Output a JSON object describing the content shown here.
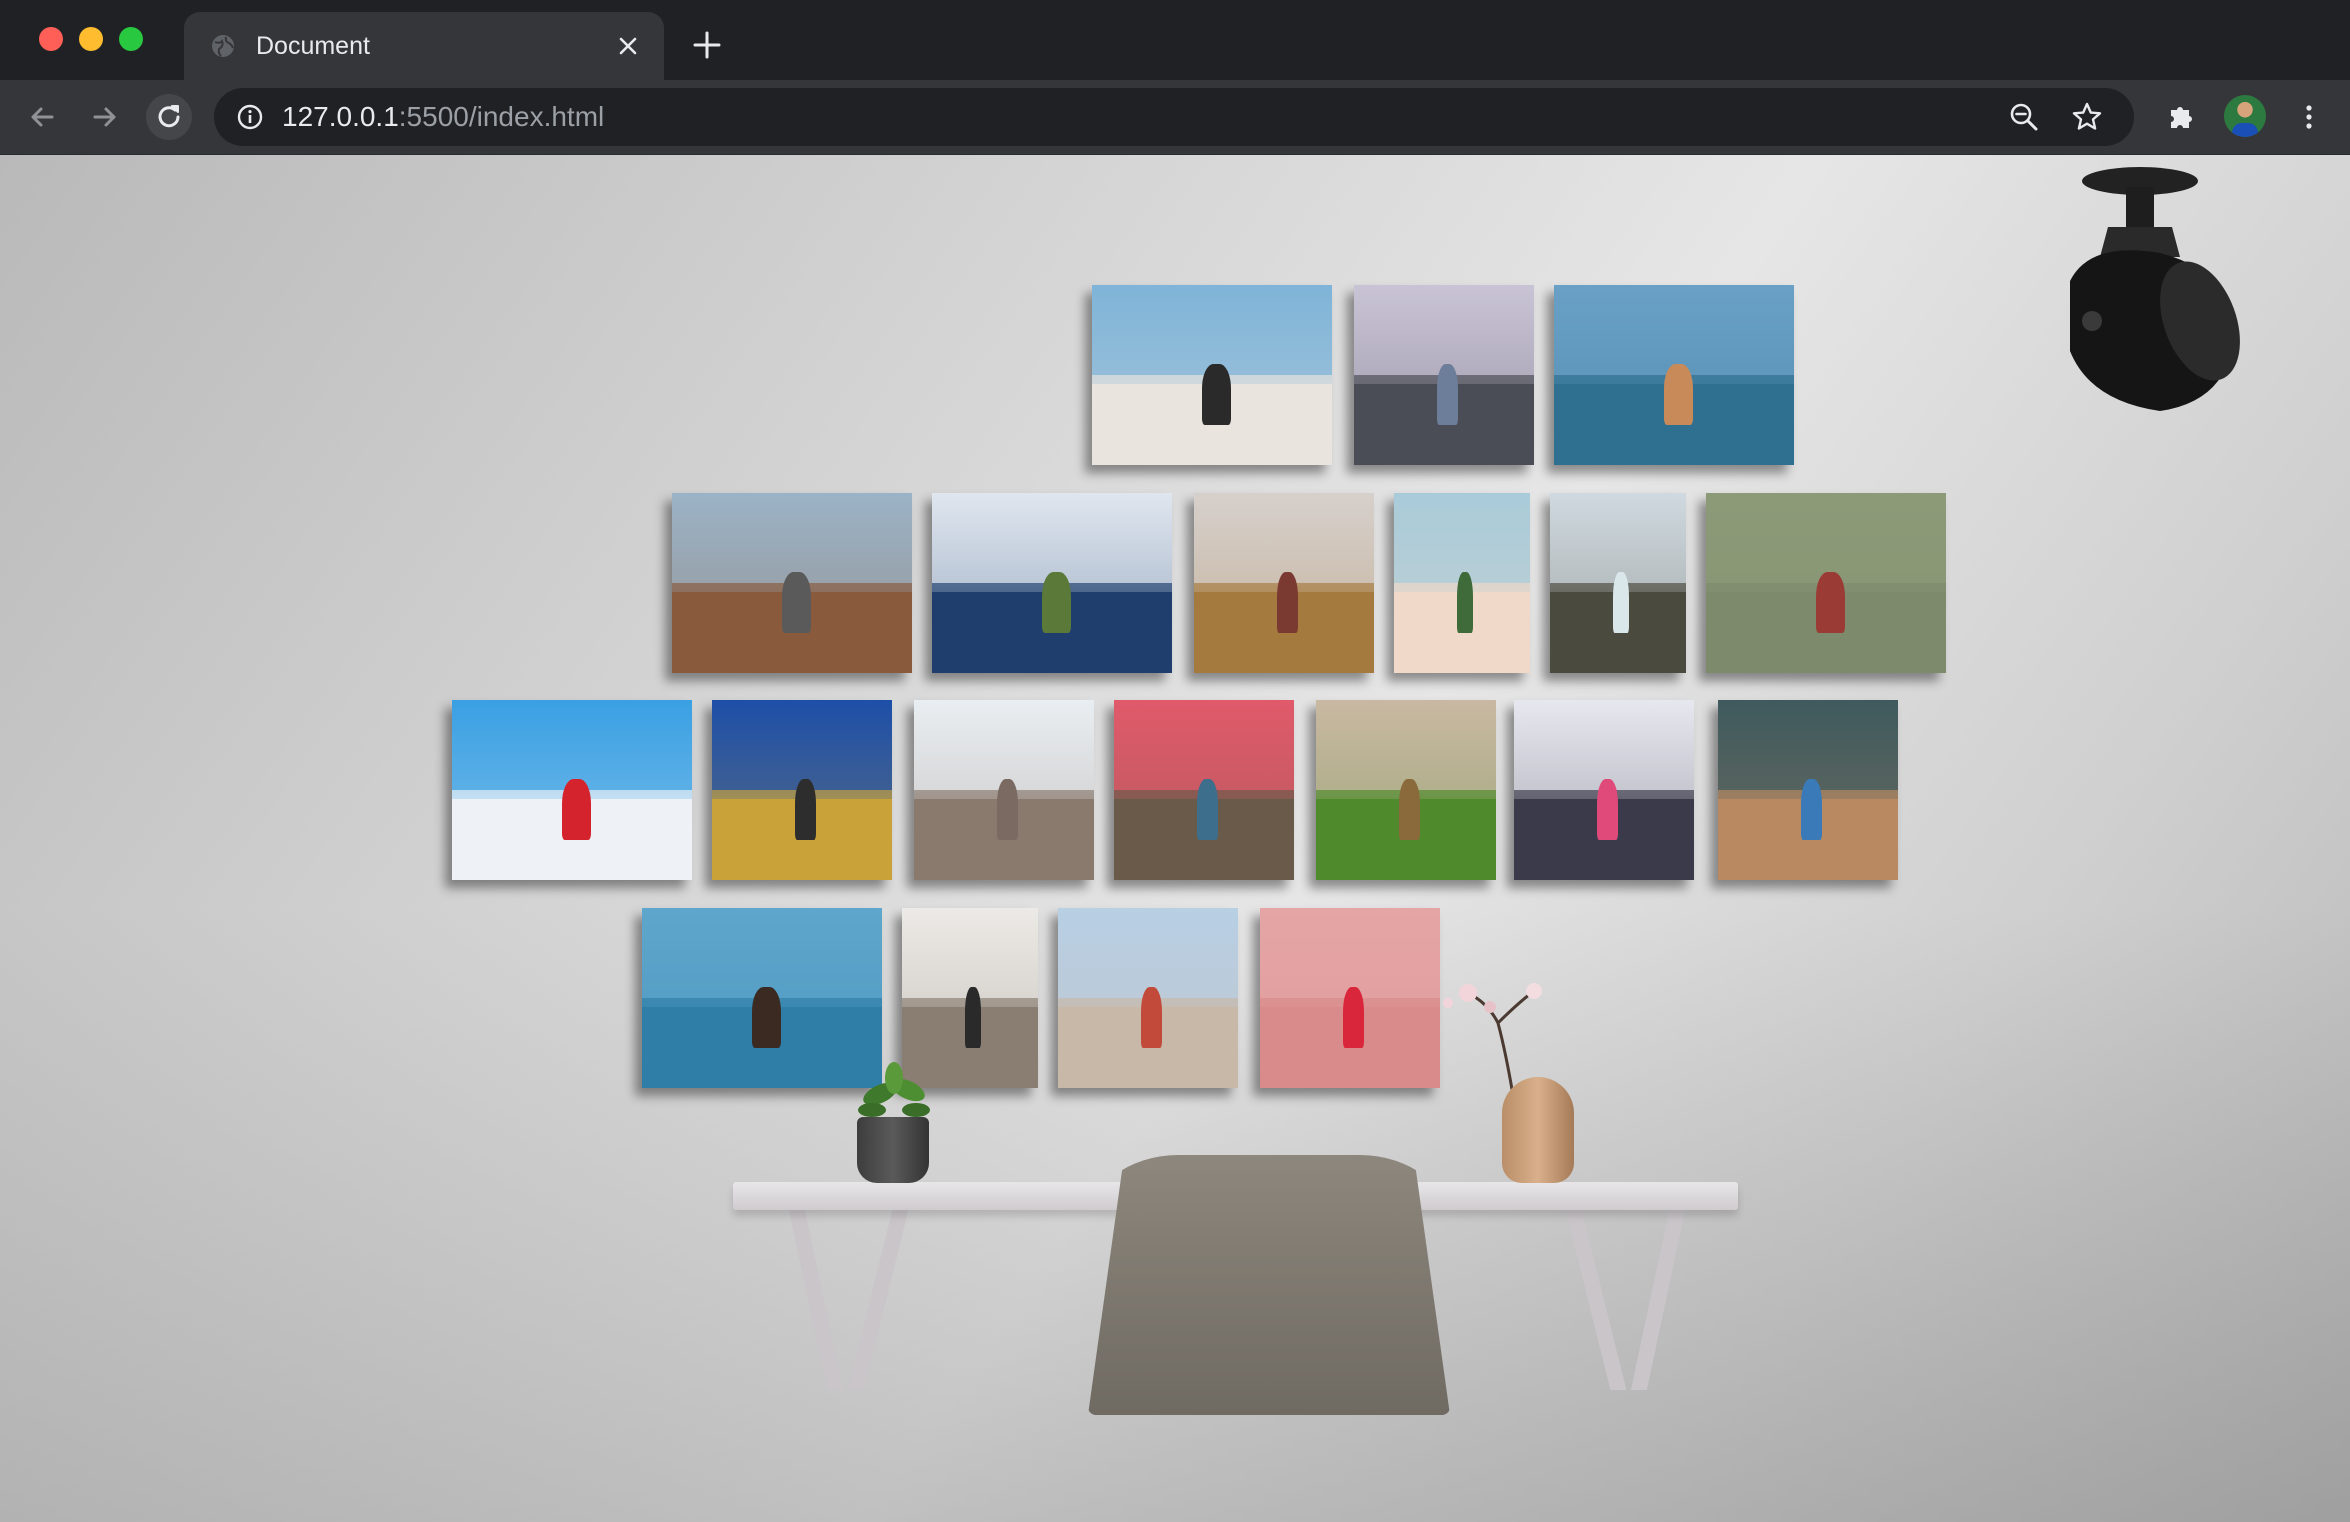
{
  "browser": {
    "tab": {
      "title": "Document"
    },
    "address_bar": {
      "host": "127.0.0.1",
      "path": ":5500/index.html"
    }
  },
  "icons": {
    "tab_favicon": "globe-icon",
    "tab_close": "close-icon",
    "new_tab": "plus-icon",
    "back": "arrow-left-icon",
    "forward": "arrow-right-icon",
    "reload": "reload-icon",
    "site_info": "info-icon",
    "zoom": "zoom-out-icon",
    "bookmark": "star-icon",
    "extensions": "puzzle-icon",
    "menu": "kebab-menu-icon"
  },
  "colors": {
    "titlebar": "#202124",
    "toolbar": "#35363a",
    "wall_light": "#e6e6e6",
    "wall_dark": "#b4b4b4"
  },
  "gallery": {
    "rows": [
      {
        "photos": [
          {
            "name": "hot-air-balloons-snow",
            "sky": "#7fb4d8",
            "ground": "#e9e4de",
            "figure": "#2a2a2a"
          },
          {
            "name": "snowy-coast-rocks",
            "sky": "#c9c3d6",
            "ground": "#4a4d55",
            "figure": "#6d7e9a"
          },
          {
            "name": "kayak-lake-mountain",
            "sky": "#6aa0c6",
            "ground": "#2f6f8f",
            "figure": "#c98a5a"
          }
        ]
      },
      {
        "photos": [
          {
            "name": "canyon-overlook",
            "sky": "#9bb3c6",
            "ground": "#8a5a3c",
            "figure": "#5a5a5a"
          },
          {
            "name": "mountain-lake-reflection",
            "sky": "#dfe6ef",
            "ground": "#1f3e6e",
            "figure": "#5b7a3a"
          },
          {
            "name": "wheat-field-blanket",
            "sky": "#d6d0cc",
            "ground": "#a57a3e",
            "figure": "#7a3a32"
          },
          {
            "name": "tropical-beach",
            "sky": "#a9cbd9",
            "ground": "#f0d9c8",
            "figure": "#3f6a3a"
          },
          {
            "name": "waterfall-cliffs",
            "sky": "#cfd9df",
            "ground": "#4b4a3e",
            "figure": "#d9e6ea"
          },
          {
            "name": "photographer-river",
            "sky": "#8c9a78",
            "ground": "#7d8a6c",
            "figure": "#9b3b35"
          }
        ]
      },
      {
        "photos": [
          {
            "name": "santorini-red-dress",
            "sky": "#3aa0e3",
            "ground": "#eef2f6",
            "figure": "#d5232e"
          },
          {
            "name": "snow-peak-meadow",
            "sky": "#1d4fa8",
            "ground": "#c9a23a",
            "figure": "#2d2d2d"
          },
          {
            "name": "snow-monkeys-hot-spring",
            "sky": "#e9eef2",
            "ground": "#8a7a6e",
            "figure": "#7a6a62"
          },
          {
            "name": "umbrella-street",
            "sky": "#e05a6a",
            "ground": "#6a5a4a",
            "figure": "#3d6e8c"
          },
          {
            "name": "green-valley-sunset",
            "sky": "#c9b8a2",
            "ground": "#4f8a2c",
            "figure": "#8a6a3a"
          },
          {
            "name": "flowers-tiles",
            "sky": "#e7e7ef",
            "ground": "#3a3a4a",
            "figure": "#e04a7a"
          },
          {
            "name": "colorful-poncho-wall",
            "sky": "#3f5a5e",
            "ground": "#b98a62",
            "figure": "#3a7ab8"
          }
        ]
      },
      {
        "photos": [
          {
            "name": "infinity-pool-ocean",
            "sky": "#5fa6cc",
            "ground": "#2f7ea8",
            "figure": "#3a2a22"
          },
          {
            "name": "white-alley-blue-pots",
            "sky": "#eceae6",
            "ground": "#8a7e72",
            "figure": "#2a2a2a"
          },
          {
            "name": "old-town-square",
            "sky": "#b8cfe4",
            "ground": "#c8b8a8",
            "figure": "#c24a3a"
          },
          {
            "name": "raspberry-tart-pink-lake",
            "sky": "#e5a5a5",
            "ground": "#d98a8a",
            "figure": "#d9263a"
          }
        ]
      }
    ]
  }
}
